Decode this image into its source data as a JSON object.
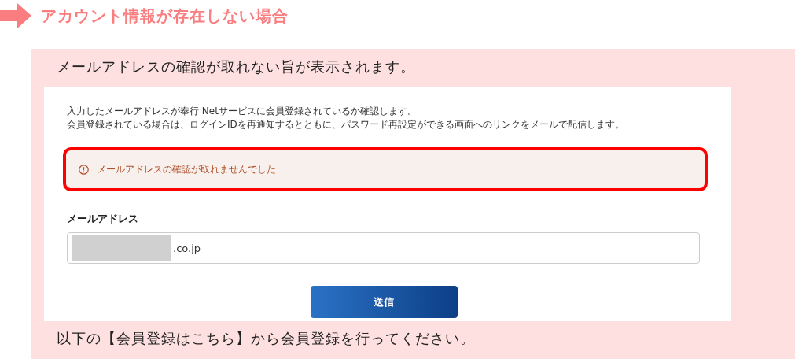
{
  "heading": "アカウント情報が存在しない場合",
  "caption": "メールアドレスの確認が取れない旨が表示されます。",
  "form": {
    "intro": [
      "入力したメールアドレスが奉行 Netサービスに会員登録されているか確認します。",
      "会員登録されている場合は、ログインIDを再通知するとともに、パスワード再設定ができる画面へのリンクをメールで配信します。"
    ],
    "error": {
      "message": "メールアドレスの確認が取れませんでした",
      "highlighted": true
    },
    "email": {
      "label": "メールアドレス",
      "value": ".co.jp",
      "redacted": true
    },
    "submit": "送信"
  },
  "footer_note": "以下の【会員登録はこちら】から会員登録を行ってください。"
}
